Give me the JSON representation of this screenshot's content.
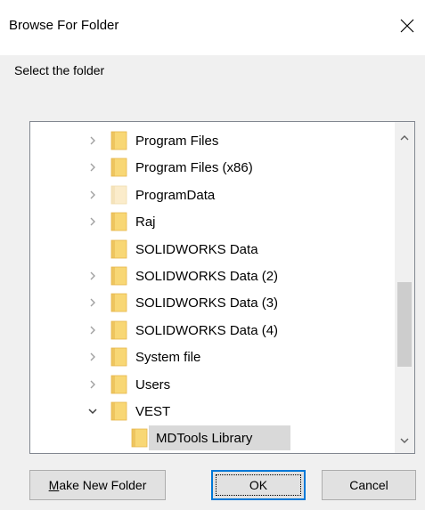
{
  "window": {
    "title": "Browse For Folder"
  },
  "instruction": "Select the folder",
  "tree": {
    "items": [
      {
        "label": "Program Files",
        "expander": "collapsed",
        "folder": "normal",
        "selected": false,
        "depth": 0
      },
      {
        "label": "Program Files (x86)",
        "expander": "collapsed",
        "folder": "normal",
        "selected": false,
        "depth": 0
      },
      {
        "label": "ProgramData",
        "expander": "collapsed",
        "folder": "hidden",
        "selected": false,
        "depth": 0
      },
      {
        "label": "Raj",
        "expander": "collapsed",
        "folder": "normal",
        "selected": false,
        "depth": 0
      },
      {
        "label": "SOLIDWORKS Data",
        "expander": "none",
        "folder": "normal",
        "selected": false,
        "depth": 0
      },
      {
        "label": "SOLIDWORKS Data (2)",
        "expander": "collapsed",
        "folder": "normal",
        "selected": false,
        "depth": 0
      },
      {
        "label": "SOLIDWORKS Data (3)",
        "expander": "collapsed",
        "folder": "normal",
        "selected": false,
        "depth": 0
      },
      {
        "label": "SOLIDWORKS Data (4)",
        "expander": "collapsed",
        "folder": "normal",
        "selected": false,
        "depth": 0
      },
      {
        "label": "System file",
        "expander": "collapsed",
        "folder": "normal",
        "selected": false,
        "depth": 0
      },
      {
        "label": "Users",
        "expander": "collapsed",
        "folder": "normal",
        "selected": false,
        "depth": 0
      },
      {
        "label": "VEST",
        "expander": "expanded",
        "folder": "normal",
        "selected": false,
        "depth": 0
      },
      {
        "label": "MDTools Library",
        "expander": "none",
        "folder": "normal",
        "selected": true,
        "depth": 1
      }
    ]
  },
  "buttons": {
    "make_new_folder": "Make New Folder",
    "ok": "OK",
    "cancel": "Cancel"
  },
  "colors": {
    "folder_yellow": "#f8d775",
    "folder_dark": "#e6b64c",
    "folder_hidden": "#fbeccb",
    "selection": "#d9d9d9",
    "accent": "#0078d7"
  }
}
